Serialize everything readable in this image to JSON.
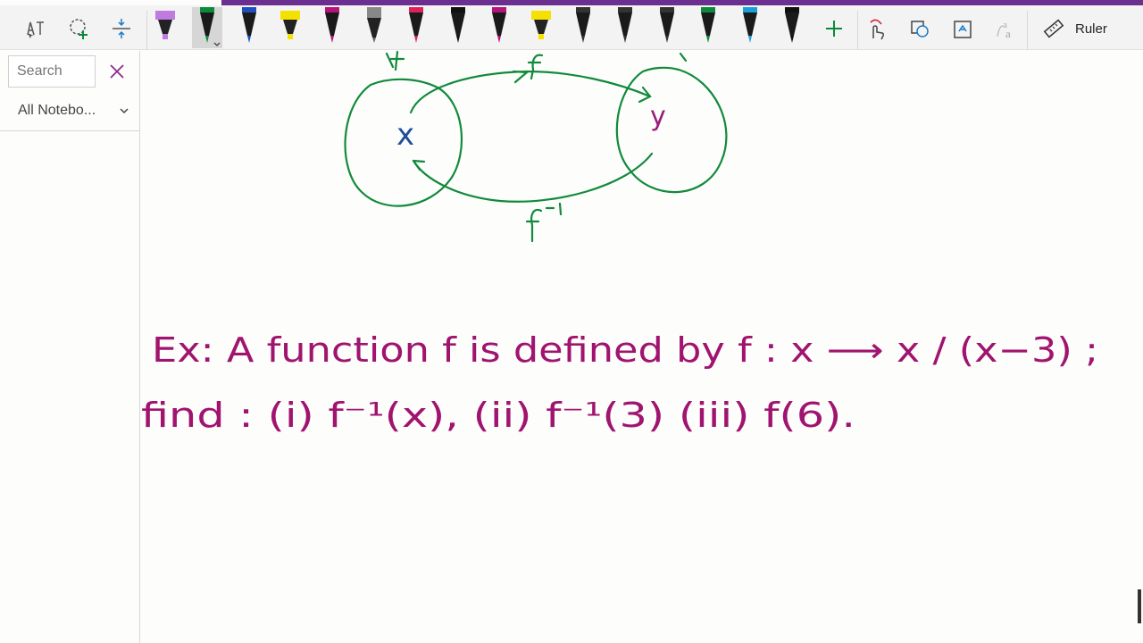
{
  "toolbar": {
    "tools": [
      {
        "icon": "lasso-text-icon"
      },
      {
        "icon": "lasso-select-icon"
      },
      {
        "icon": "add-space-icon"
      }
    ],
    "pens": [
      {
        "color": "#c07be0",
        "type": "highlighter"
      },
      {
        "color": "#0a8a3a",
        "type": "pen",
        "selected": true
      },
      {
        "color": "#1f4fbf",
        "type": "pen"
      },
      {
        "color": "#f5e100",
        "type": "highlighter"
      },
      {
        "color": "#b5147a",
        "type": "pen"
      },
      {
        "color": "#7f7f7f",
        "type": "pencil"
      },
      {
        "color": "#e0205a",
        "type": "pen"
      },
      {
        "color": "#111111",
        "type": "pen"
      },
      {
        "color": "#b5147a",
        "type": "pen"
      },
      {
        "color": "#f5e100",
        "type": "highlighter"
      },
      {
        "color": "#333333",
        "type": "pen"
      },
      {
        "color": "#333333",
        "type": "pen"
      },
      {
        "color": "#333333",
        "type": "pen"
      },
      {
        "color": "#0a8a3a",
        "type": "pen"
      },
      {
        "color": "#1aa0d8",
        "type": "pen"
      },
      {
        "color": "#111111",
        "type": "pen"
      }
    ],
    "add_pen_icon": "plus-icon",
    "right_tools": [
      "touch-draw-icon",
      "ink-to-shape-icon",
      "ink-to-text-icon",
      "ink-to-math-icon"
    ],
    "ruler_label": "Ruler"
  },
  "sidebar": {
    "search_placeholder": "Search",
    "notebook_filter": "All Notebo..."
  },
  "canvas": {
    "diagram_labels": {
      "set_x": "x",
      "set_y": "y",
      "map_forward": "f",
      "map_inverse": "f⁻¹"
    },
    "example_line1": "Ex: A function f is defined by f : x ⟶ x / (x−3) ;",
    "example_line2": "find : (i) f⁻¹(x), (ii) f⁻¹(3) (iii) f(6).",
    "colors": {
      "diagram": "#128a3c",
      "set_x": "#1f4f9a",
      "set_y": "#9a1c7a",
      "text": "#a0146f"
    }
  }
}
